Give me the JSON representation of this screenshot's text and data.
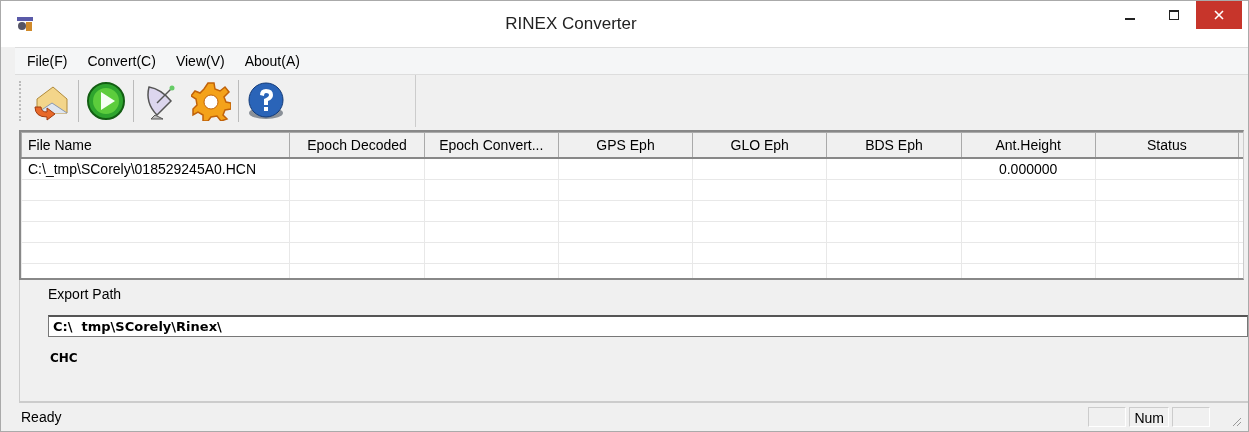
{
  "window": {
    "title": "RINEX Converter"
  },
  "menu": [
    "File(F)",
    "Convert(C)",
    "View(V)",
    "About(A)"
  ],
  "toolbar": [
    {
      "kind": "open"
    },
    {
      "kind": "play"
    },
    {
      "kind": "dish"
    },
    {
      "kind": "gear"
    },
    {
      "kind": "help"
    }
  ],
  "table": {
    "columns": [
      "File Name",
      "Epoch Decoded",
      "Epoch Convert...",
      "GPS Eph",
      "GLO Eph",
      "BDS Eph",
      "Ant.Height",
      "Status"
    ],
    "rows": [
      [
        "C:\\_tmp\\SCorely\\018529245A0.HCN",
        "",
        "",
        "",
        "",
        "",
        "0.000000",
        ""
      ]
    ]
  },
  "export": {
    "label": "Export Path",
    "value": "C:\\  tmp\\SCorely\\Rinex\\",
    "note": "CHC"
  },
  "status_bar": {
    "text": "Ready",
    "num_indicator": "Num"
  }
}
